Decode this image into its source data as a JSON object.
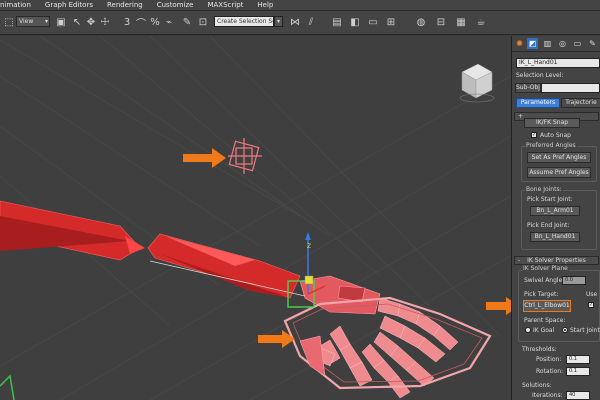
{
  "menubar": {
    "items": [
      "nimation",
      "Graph Editors",
      "Rendering",
      "Customize",
      "MAXScript",
      "Help"
    ]
  },
  "toolbar": {
    "view_value": "View",
    "selection_set_placeholder": "Create Selection Se"
  },
  "command_panel": {
    "object_name": "IK_L_Hand01",
    "selection_level_label": "Selection Level:",
    "sub_object_label": "Sub-Object",
    "tab_parameters": "Parameters",
    "tab_trajectories": "Trajectorie",
    "ik_fk_snap": "IK/FK Snap",
    "auto_snap": "Auto Snap",
    "preferred_angles_title": "Preferred Angles",
    "set_as_pref": "Set As Pref Angles",
    "assume_pref": "Assume Pref Angles",
    "bone_joints_title": "Bone Joints:",
    "pick_start_label": "Pick Start Joint:",
    "start_joint": "Bn_L_Arm01",
    "pick_end_label": "Pick End Joint:",
    "end_joint": "Bn_L_Hand01",
    "ik_solver_props": "IK Solver Properties",
    "ik_solver_plane": "IK Solver Plane",
    "swivel_label": "Swivel Angle:",
    "swivel_value": "0.0",
    "pick_target_label": "Pick Target:",
    "use_label": "Use",
    "pick_target_value": "Ctrl_L_Elbow01",
    "parent_space_label": "Parent Space:",
    "ik_goal": "IK Goal",
    "start_joint_radio": "Start Joint",
    "thresholds_label": "Thresholds:",
    "position_label": "Position:",
    "position_value": "0.1",
    "rotation_label": "Rotation:",
    "rotation_value": "0.1",
    "solutions_label": "Solutions:",
    "iterations_label": "Iterations:",
    "iterations_value": "40"
  },
  "colors": {
    "accent": "#f07a1a",
    "bone_red": "#e03030",
    "helper_pink": "#f07a82",
    "tab_blue": "#3d7fd6"
  },
  "icons": [
    "select-icon",
    "move-icon",
    "rotate-icon",
    "scale-icon",
    "snap-icon",
    "mirror-icon",
    "align-icon",
    "layer-icon",
    "render-icon",
    "teapot-icon"
  ]
}
